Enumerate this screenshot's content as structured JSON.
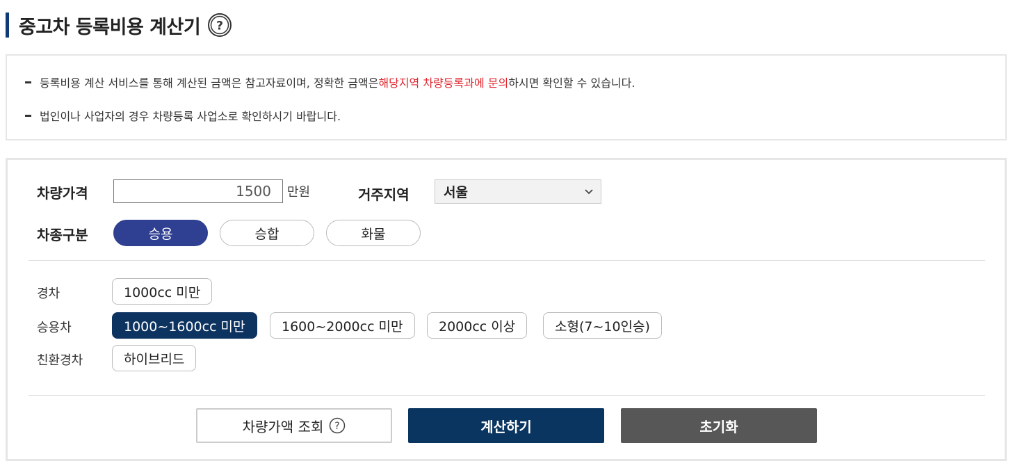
{
  "header": {
    "title": "중고차 등록비용 계산기",
    "help_icon": "question-circle-icon"
  },
  "notice": {
    "line1_prefix": "등록비용 계산 서비스를 통해 계산된 금액은 참고자료이며, 정확한 금액은 ",
    "line1_highlight": "해당지역 차량등록과에 문의",
    "line1_suffix": "하시면 확인할 수 있습니다.",
    "line2": "법인이나 사업자의 경우 차량등록 사업소로 확인하시기 바랍니다.",
    "highlight_color": "#e0262f"
  },
  "form": {
    "price_label": "차량가격",
    "price_value": "1500",
    "price_unit": "만원",
    "region_label": "거주지역",
    "region_selected": "서울",
    "vehicle_type_label": "차종구분",
    "vehicle_types": [
      "승용",
      "승합",
      "화물"
    ],
    "vehicle_type_selected": "승용"
  },
  "categories": {
    "light_label": "경차",
    "light_options": [
      "1000cc 미만"
    ],
    "passenger_label": "승용차",
    "passenger_options": [
      "1000~1600cc 미만",
      "1600~2000cc 미만",
      "2000cc 이상",
      "소형(7~10인승)"
    ],
    "passenger_selected": "1000~1600cc 미만",
    "eco_label": "친환경차",
    "eco_options": [
      "하이브리드"
    ]
  },
  "actions": {
    "lookup_label": "차량가액 조회",
    "calculate_label": "계산하기",
    "reset_label": "초기화"
  },
  "colors": {
    "accent": "#0f3a75",
    "pill_active": "#2f3f91",
    "chip_active": "#0d3360",
    "primary_button": "#0b3561",
    "reset_button": "#575757"
  }
}
